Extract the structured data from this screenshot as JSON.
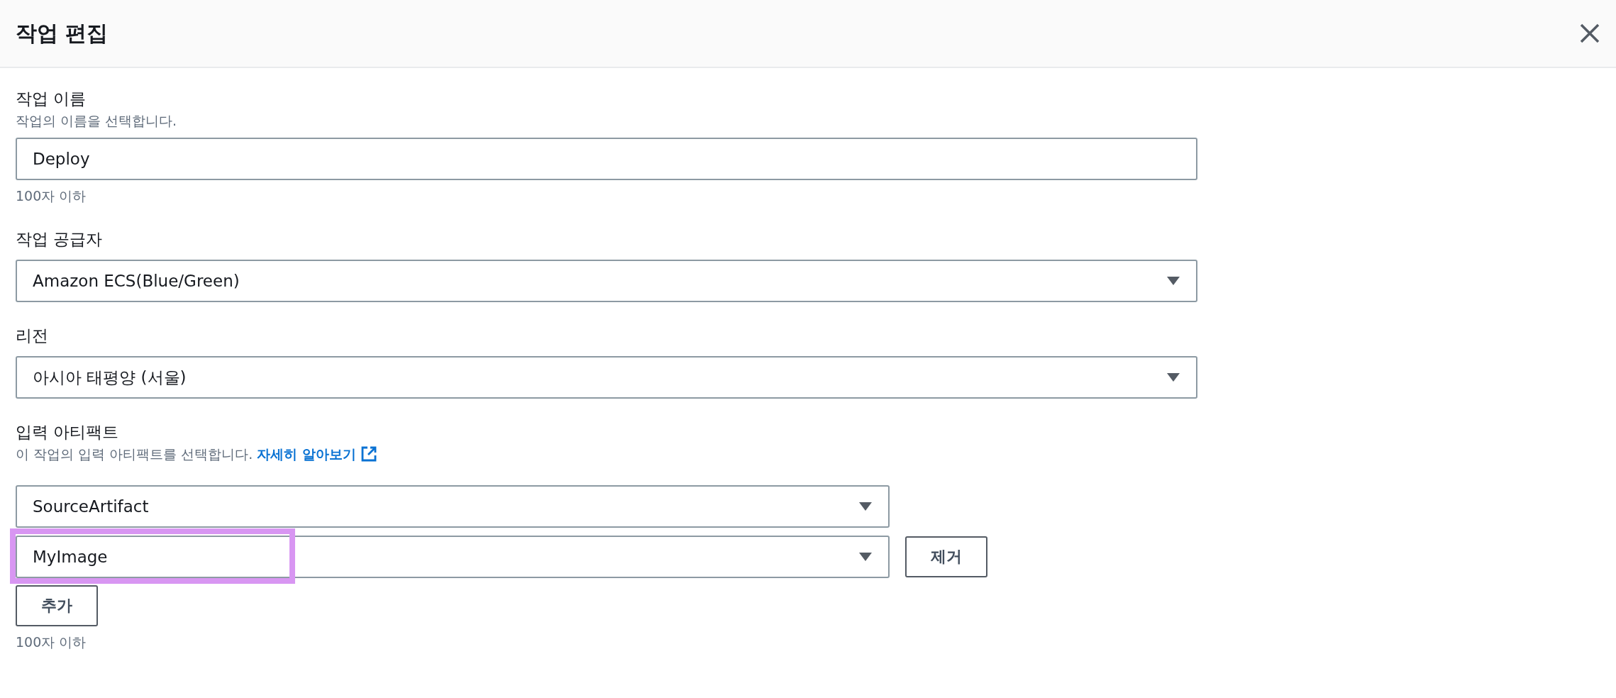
{
  "dialog": {
    "title": "작업 편집"
  },
  "fields": [
    {
      "kind": "text",
      "label": "작업 이름",
      "description": "작업의 이름을 선택합니다.",
      "value": "Deploy",
      "constraint": "100자 이하"
    },
    {
      "kind": "select",
      "label": "작업 공급자",
      "value": "Amazon ECS(Blue/Green)"
    },
    {
      "kind": "select",
      "label": "리전",
      "value": "아시아 태평양 (서울)"
    }
  ],
  "input_artifacts": {
    "label": "입력 아티팩트",
    "description": "이 작업의 입력 아티팩트를 선택합니다.",
    "link": "자세히 알아보기",
    "items": [
      {
        "value": "SourceArtifact",
        "highlighted": false
      },
      {
        "value": "MyImage",
        "highlighted": true,
        "remove_button": "제거"
      }
    ],
    "add_button": "추가",
    "constraint": "100자 이하"
  }
}
